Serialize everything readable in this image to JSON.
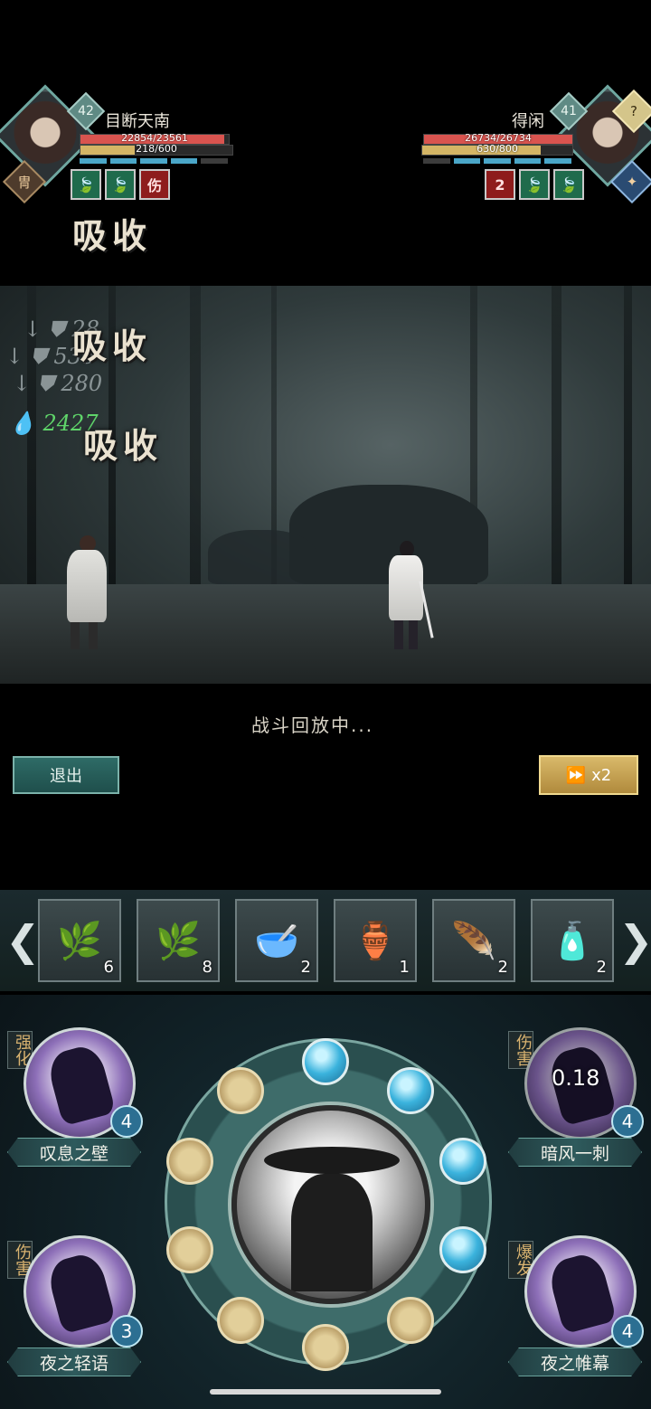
{
  "player_left": {
    "name": "目断天南",
    "level": "42",
    "hp_text": "22854/23561",
    "hp_fraction": 0.97,
    "mp_text": "218/600",
    "mp_fraction": 0.36,
    "buffs": [
      "🍃",
      "🍃",
      "伤"
    ],
    "title_icon": "冑"
  },
  "player_right": {
    "name": "得闲",
    "level": "41",
    "hp_text": "26734/26734",
    "hp_fraction": 1.0,
    "mp_text": "630/800",
    "mp_fraction": 0.79,
    "buffs": [
      "2",
      "🍃",
      "🍃"
    ],
    "badge": "?"
  },
  "floating_texts": {
    "absorb_1": "吸收",
    "absorb_2": "吸收",
    "absorb_3": "吸收"
  },
  "damage_numbers": [
    "28",
    "536",
    "280",
    "2427"
  ],
  "replay": {
    "status": "战斗回放中...",
    "exit_label": "退出",
    "speed_label": "x2"
  },
  "items": [
    {
      "icon": "🌿",
      "count": "6"
    },
    {
      "icon": "🌿",
      "count": "8"
    },
    {
      "icon": "🥣",
      "count": "2"
    },
    {
      "icon": "🏺",
      "count": "1"
    },
    {
      "icon": "🪶",
      "count": "2"
    },
    {
      "icon": "🧴",
      "count": "2"
    }
  ],
  "skills": {
    "top_left": {
      "name": "叹息之壁",
      "tag": "强化",
      "count": "4"
    },
    "top_right": {
      "name": "暗风一刺",
      "tag": "伤害",
      "count": "4",
      "cooldown": "0.18"
    },
    "bottom_left": {
      "name": "夜之轻语",
      "tag": "伤害",
      "count": "3"
    },
    "bottom_right": {
      "name": "夜之帷幕",
      "tag": "爆发",
      "count": "4"
    }
  },
  "colors": {
    "hp_bar": "#d9544f",
    "mp_bar": "#d4b565",
    "energy_seg": "#4aa6c8",
    "accent_teal": "#2e6b66",
    "speed_button": "#c9a553"
  }
}
